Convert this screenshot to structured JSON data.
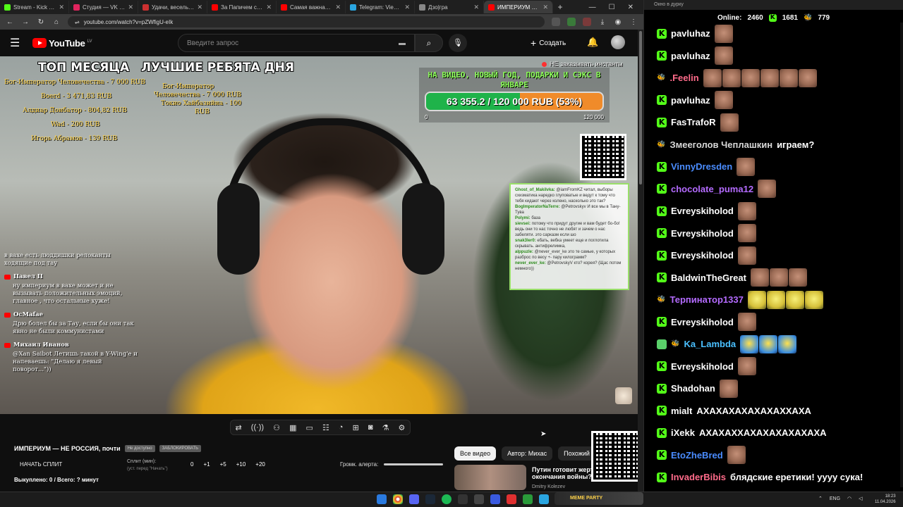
{
  "tabs": [
    {
      "title": "Stream - Kick Dashboard",
      "color": "#53fc18"
    },
    {
      "title": "Студия — VK Видео Live",
      "color": "#e0245e"
    },
    {
      "title": "Удачи, веселья, не сдох",
      "color": "#cc3030"
    },
    {
      "title": "За Папичем следят в реал",
      "color": "#ff0000"
    },
    {
      "title": "Самая важная машина",
      "color": "#ff0000"
    },
    {
      "title": "Telegram: View @grok",
      "color": "#2aa5e0"
    },
    {
      "title": "Дзо|гра",
      "color": "#888888"
    },
    {
      "title": "ИМПЕРИУМ — НЕ РОС",
      "color": "#ff0000",
      "active": true
    }
  ],
  "address": "youtube.com/watch?v=pZWfigU-eIk",
  "yt": {
    "logo": "YouTube",
    "country": "LV",
    "search_placeholder": "Введите запрос",
    "create_label": "Создать"
  },
  "overlay": {
    "top_month": "ТОП МЕСЯЦА",
    "best_day": "ЛУЧШИЕ РЕБЯТА ДНЯ",
    "month_donors": [
      "Бог-Император Человечества - 7 000 RUB",
      "Boerd - 3 471,83 RUB",
      "Алдиар Донбатор - 804,82 RUB",
      "Wad - 200 RUB",
      "Игорь Абрамов - 139 RUB"
    ],
    "day_donors": [
      "Бог-Император",
      "Человечества - 7 000 RUB",
      "Токио Хайбазийна - 100",
      "RUB"
    ],
    "no_instant": "НЕ заказывать инстанты",
    "goal_title": "НА ВИДЕО, НОВЫЙ ГОД, ПОДАРКИ И СЭКС В ЯНВАРЕ",
    "goal_text": "63 355.2 / 120 000 RUB (53%)",
    "goal_fraction": 0.53,
    "goal_min": "0",
    "goal_max": "120 000",
    "mini_chat": [
      {
        "user": "Ghost_of_Makilvka:",
        "text": "@iamFromKZ читал, выборы схизматика наредко глуповатые и ведут к тому что тебя кидают через колено, насколько это так?"
      },
      {
        "user": "BogImperatorNaTerre:",
        "text": "@Petrovskyv И все мы в Тану-Тува"
      },
      {
        "user": "Polymi:",
        "text": "база"
      },
      {
        "user": "sievsei:",
        "text": "потому что придут другие и вам будет бо-бо! ведь они то нас точно не любят и зачем о нас забеляти. это сарказм если шо"
      },
      {
        "user": "snak3ler0:",
        "text": "ебать, вебка умеет еще и поглотила скрывать. антифрелимка,"
      },
      {
        "user": "alppuzle:",
        "text": "@never_ever_ke это те самые, у которых разброс по весу +- пару килограмм?"
      },
      {
        "user": "never_ever_ke:",
        "text": "@PetrovskyV кто? корея? (Щас потом немного))"
      }
    ],
    "left_chat_intro": "в вахе есть люддишки релоканты ходящие под тау",
    "left_chat": [
      {
        "author": "Павел П",
        "text": "ну империум в вахе может и не вызывать положительных эмоций, главное , что остальные хуже!"
      },
      {
        "author": "OcMafae",
        "text": "Дрю болел бы за Тау, если бы они так явно не были коммунистами"
      },
      {
        "author": "Михаил Иванов",
        "text": "@Xan Saibot Летишь такой в Y-Wing'е и напеваешь: \"Делаю я левый поворот...\"))"
      }
    ]
  },
  "controls": [
    "loop",
    "broadcast",
    "camera-switch",
    "clip",
    "pip",
    "caption",
    "speed",
    "screen-text",
    "screenshot",
    "lab",
    "settings"
  ],
  "below": {
    "video_title": "ИМПЕРИУМ — НЕ РОССИЯ, почти",
    "pill1": "Не доступно",
    "pill2": "ЗАБЛОКИРОВАТЬ",
    "start_split": "НАЧАТЬ СПЛИТ",
    "split_label": "Сплит (мин):",
    "split_hint": "(уст. перед \"Начать\")",
    "split_values": [
      "0",
      "+1",
      "+5",
      "+10",
      "+20"
    ],
    "alert_label": "Громк. алерта:",
    "bought": "Выкуплено: 0 / Всего: ? минут"
  },
  "chips": [
    "Все видео",
    "Автор: Михас",
    "Похожий ко"
  ],
  "rec": {
    "title": "Путин готовит жертв",
    "title2": "окончания войны? В",
    "author": "Dmitry Kolezev"
  },
  "meme_label": "MEME PARTY",
  "tray": {
    "lang": "ENG",
    "time": "18:23",
    "date": "11.04.2026"
  },
  "chatwin": {
    "title": "Окно в дурку",
    "online_label": "Online:",
    "online": "2460",
    "kick_count": "1681",
    "bee_count": "779",
    "messages": [
      {
        "user": "pavluhaz",
        "color": "#ffffff",
        "badge": "kick",
        "emotes": 1
      },
      {
        "user": "pavluhaz",
        "color": "#ffffff",
        "badge": "kick",
        "emotes": 1
      },
      {
        "user": ".Feelin",
        "color": "#ff6b8a",
        "badge": "bee",
        "emotes": 6
      },
      {
        "user": "pavluhaz",
        "color": "#ffffff",
        "badge": "kick",
        "emotes": 1
      },
      {
        "user": "FasTrafoR",
        "color": "#ffffff",
        "badge": "kick",
        "emotes": 1
      },
      {
        "user": "Змееголов Чеплашкин",
        "color": "#d8d8d8",
        "badge": "bee",
        "text": "играем?"
      },
      {
        "user": "VinnyDresden",
        "color": "#4a8cff",
        "badge": "kick",
        "emotes": 1
      },
      {
        "user": "chocolate_puma12",
        "color": "#b46bff",
        "badge": "kick",
        "emotes": 1
      },
      {
        "user": "Evreyskiholod",
        "color": "#ffffff",
        "badge": "kick",
        "emotes": 1
      },
      {
        "user": "Evreyskiholod",
        "color": "#ffffff",
        "badge": "kick",
        "emotes": 1
      },
      {
        "user": "Evreyskiholod",
        "color": "#ffffff",
        "badge": "kick",
        "emotes": 1
      },
      {
        "user": "BaldwinTheGreat",
        "color": "#ffffff",
        "badge": "kick",
        "emotes": 3
      },
      {
        "user": "Терпинатор1337",
        "color": "#b46bff",
        "badge": "bee",
        "emotes": 4,
        "emote_style": "yel"
      },
      {
        "user": "Evreyskiholod",
        "color": "#ffffff",
        "badge": "kick",
        "emotes": 1
      },
      {
        "user": "Ka_Lambda",
        "color": "#4ac0ff",
        "badge": "shield-bee",
        "emotes": 3,
        "emote_style": "bee"
      },
      {
        "user": "Evreyskiholod",
        "color": "#ffffff",
        "badge": "kick",
        "emotes": 1
      },
      {
        "user": "Shadohan",
        "color": "#ffffff",
        "badge": "kick",
        "emotes": 1
      },
      {
        "user": "mialt",
        "color": "#ffffff",
        "badge": "kick",
        "text": "АХАХАХАХАХАХАХХАХА"
      },
      {
        "user": "iXekk",
        "color": "#ffffff",
        "badge": "kick",
        "text": "АХАХАХХАХАХАХАХАХАХА"
      },
      {
        "user": "EtoZheBred",
        "color": "#4a8cff",
        "badge": "kick",
        "emotes": 1
      },
      {
        "user": "InvaderBibis",
        "color": "#ff6b8a",
        "badge": "kick",
        "text": "блядские еретики! уууу сука!"
      }
    ]
  }
}
